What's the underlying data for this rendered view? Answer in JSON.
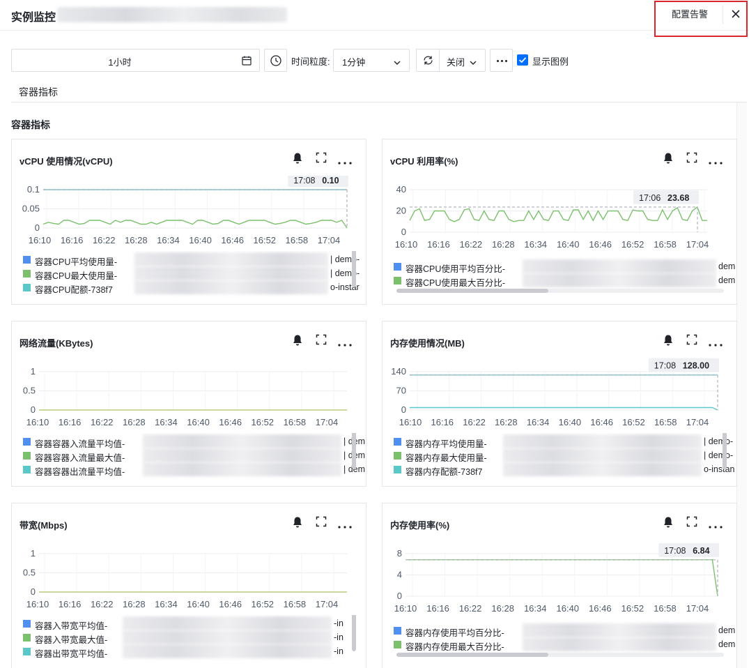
{
  "header": {
    "title": "实例监控",
    "config_alert_label": "配置告警"
  },
  "toolbar": {
    "time_range": "1小时",
    "granularity_label": "时间粒度:",
    "granularity_value": "1分钟",
    "auto_refresh_value": "关闭",
    "show_legend_label": "显示图例",
    "show_legend_checked": true
  },
  "tabs": [
    {
      "label": "容器指标",
      "active": true
    }
  ],
  "section_title": "容器指标",
  "x_ticks": [
    "16:10",
    "16:16",
    "16:22",
    "16:28",
    "16:34",
    "16:40",
    "16:46",
    "16:52",
    "16:58",
    "17:04"
  ],
  "charts": [
    {
      "title": "vCPU 使用情况(vCPU)",
      "tooltip_time": "17:08",
      "tooltip_value": "0.10",
      "y_ticks": [
        "0.1",
        "0.05",
        "0"
      ],
      "legend": [
        {
          "name": "容器CPU平均使用量-",
          "suffix": "| demo-",
          "color": "#4e8ff0"
        },
        {
          "name": "容器CPU最大使用量-",
          "suffix": "| demo-",
          "color": "#7cc06c"
        },
        {
          "name": "容器CPU配额-738f7",
          "suffix": "o-instar",
          "color": "#5ac8c8"
        }
      ]
    },
    {
      "title": "vCPU 利用率(%)",
      "tooltip_time": "17:06",
      "tooltip_value": "23.68",
      "y_ticks": [
        "40",
        "20",
        "0"
      ],
      "legend": [
        {
          "name": "容器CPU使用平均百分比-",
          "suffix": "dem",
          "color": "#4e8ff0"
        },
        {
          "name": "容器CPU使用最大百分比-",
          "suffix": "dem",
          "color": "#7cc06c"
        }
      ]
    },
    {
      "title": "网络流量(KBytes)",
      "y_ticks": [
        "1",
        "0.5",
        "0"
      ],
      "legend": [
        {
          "name": "容器容器入流量平均值-",
          "suffix": "| dem",
          "color": "#4e8ff0"
        },
        {
          "name": "容器容器入流量最大值-",
          "suffix": "| dem",
          "color": "#7cc06c"
        },
        {
          "name": "容器容器出流量平均值-",
          "suffix": "| dem",
          "color": "#5ac8c8"
        }
      ]
    },
    {
      "title": "内存使用情况(MB)",
      "tooltip_time": "17:08",
      "tooltip_value": "128.00",
      "y_ticks": [
        "140",
        "70",
        "0"
      ],
      "legend": [
        {
          "name": "容器内存平均使用量-",
          "suffix": "| demo-",
          "color": "#4e8ff0"
        },
        {
          "name": "容器内存最大使用量-",
          "suffix": "| demo-",
          "color": "#7cc06c"
        },
        {
          "name": "容器内存配额-738f7",
          "suffix": "o-instan",
          "color": "#5ac8c8"
        }
      ]
    },
    {
      "title": "带宽(Mbps)",
      "y_ticks": [
        "1",
        "0.5",
        "0"
      ],
      "legend": [
        {
          "name": "容器入带宽平均值-",
          "suffix": "-in",
          "color": "#4e8ff0"
        },
        {
          "name": "容器入带宽最大值-",
          "suffix": "-in",
          "color": "#7cc06c"
        },
        {
          "name": "容器出带宽平均值-",
          "suffix": "-in",
          "color": "#5ac8c8"
        }
      ]
    },
    {
      "title": "内存使用率(%)",
      "tooltip_time": "17:08",
      "tooltip_value": "6.84",
      "y_ticks": [
        "8",
        "4",
        "0"
      ],
      "legend": [
        {
          "name": "容器内存使用平均百分比-",
          "suffix": "dem",
          "color": "#4e8ff0"
        },
        {
          "name": "容器内存使用最大百分比-",
          "suffix": "dem",
          "color": "#7cc06c"
        }
      ]
    }
  ],
  "chart_data": [
    {
      "type": "line",
      "title": "vCPU 使用情况(vCPU)",
      "ylim": [
        0,
        0.1
      ],
      "x_range": [
        "16:09",
        "17:08"
      ],
      "series": [
        {
          "name": "容器CPU平均使用量",
          "values": [
            0.01,
            0.015,
            0.012,
            0.01,
            0.02,
            0.02,
            0.015,
            0.01,
            0.012,
            0.02,
            0.02,
            0.02,
            0.015,
            0.01,
            0.02,
            0.015,
            0.02,
            0.02,
            0.015,
            0.01,
            0.01,
            0.015,
            0.01,
            0.015,
            0.02,
            0.02,
            0.02,
            0.02,
            0.015,
            0.01,
            0.02,
            0.02,
            0.015,
            0.01,
            0.012,
            0.02,
            0.02,
            0.015,
            0.01,
            0.015,
            0.02,
            0.02,
            0.02,
            0.02,
            0.015,
            0.01,
            0.012,
            0.015,
            0.02,
            0.02,
            0.015,
            0.01,
            0.012,
            0.015,
            0.02,
            0.02,
            0.02,
            0.015,
            0.02,
            0.0
          ]
        },
        {
          "name": "容器CPU配额",
          "values": [
            0.1,
            0.1,
            0.1,
            0.1,
            0.1,
            0.1,
            0.1,
            0.1,
            0.1,
            0.1,
            0.1,
            0.1,
            0.1,
            0.1,
            0.1,
            0.1,
            0.1,
            0.1,
            0.1,
            0.1,
            0.1,
            0.1,
            0.1,
            0.1,
            0.1,
            0.1,
            0.1,
            0.1,
            0.1,
            0.1,
            0.1,
            0.1,
            0.1,
            0.1,
            0.1,
            0.1,
            0.1,
            0.1,
            0.1,
            0.1,
            0.1,
            0.1,
            0.1,
            0.1,
            0.1,
            0.1,
            0.1,
            0.1,
            0.1,
            0.1,
            0.1,
            0.1,
            0.1,
            0.1,
            0.1,
            0.1,
            0.1,
            0.1,
            0.1,
            0.1
          ]
        }
      ]
    },
    {
      "type": "line",
      "title": "vCPU 利用率(%)",
      "ylim": [
        0,
        40
      ],
      "x_range": [
        "16:09",
        "17:08"
      ],
      "series": [
        {
          "name": "容器CPU使用最大百分比",
          "values": [
            11,
            20,
            22,
            11,
            12,
            20,
            20,
            20,
            12,
            10,
            12,
            21,
            22,
            12,
            11,
            20,
            12,
            11,
            20,
            20,
            12,
            10,
            11,
            11,
            20,
            12,
            20,
            12,
            11,
            20,
            20,
            12,
            11,
            21,
            21,
            12,
            20,
            11,
            20,
            12,
            20,
            20,
            20,
            12,
            11,
            21,
            20,
            20,
            12,
            11,
            11,
            21,
            12,
            20,
            23,
            12,
            11,
            20,
            23.68,
            11,
            11
          ]
        }
      ]
    },
    {
      "type": "line",
      "title": "网络流量(KBytes)",
      "ylim": [
        0,
        1
      ],
      "x_range": [
        "16:09",
        "17:08"
      ],
      "series": [
        {
          "name": "容器容器入流量最大值",
          "values": [
            0,
            0,
            0,
            0,
            0,
            0,
            0,
            0,
            0,
            0,
            0,
            0,
            0,
            0,
            0,
            0,
            0,
            0,
            0,
            0,
            0,
            0,
            0,
            0,
            0,
            0,
            0,
            0,
            0,
            0,
            0,
            0,
            0,
            0,
            0,
            0,
            0,
            0,
            0,
            0,
            0,
            0,
            0,
            0,
            0,
            0,
            0,
            0,
            0,
            0,
            0,
            0,
            0,
            0,
            0,
            0,
            0,
            0,
            0,
            0
          ]
        }
      ]
    },
    {
      "type": "line",
      "title": "内存使用情况(MB)",
      "ylim": [
        0,
        140
      ],
      "x_range": [
        "16:09",
        "17:08"
      ],
      "series": [
        {
          "name": "容器内存配额",
          "values": [
            128,
            128,
            128,
            128,
            128,
            128,
            128,
            128,
            128,
            128,
            128,
            128,
            128,
            128,
            128,
            128,
            128,
            128,
            128,
            128,
            128,
            128,
            128,
            128,
            128,
            128,
            128,
            128,
            128,
            128,
            128,
            128,
            128,
            128,
            128,
            128,
            128,
            128,
            128,
            128,
            128,
            128,
            128,
            128,
            128,
            128,
            128,
            128,
            128,
            128,
            128,
            128,
            128,
            128,
            128,
            128,
            128,
            128,
            128,
            128.0
          ]
        },
        {
          "name": "容器内存平均使用量",
          "values": [
            9,
            9,
            9,
            9,
            9,
            9,
            9,
            9,
            9,
            9,
            9,
            9,
            9,
            9,
            9,
            9,
            9,
            9,
            9,
            9,
            9,
            9,
            9,
            9,
            9,
            9,
            9,
            9,
            9,
            9,
            9,
            9,
            9,
            9,
            9,
            9,
            9,
            9,
            9,
            9,
            9,
            9,
            9,
            9,
            9,
            9,
            9,
            9,
            9,
            9,
            9,
            9,
            9,
            9,
            9,
            9,
            9,
            9,
            9,
            0
          ]
        }
      ]
    },
    {
      "type": "line",
      "title": "带宽(Mbps)",
      "ylim": [
        0,
        1
      ],
      "x_range": [
        "16:09",
        "17:08"
      ],
      "series": [
        {
          "name": "容器入带宽最大值",
          "values": [
            0,
            0,
            0,
            0,
            0,
            0,
            0,
            0,
            0,
            0,
            0,
            0,
            0,
            0,
            0,
            0,
            0,
            0,
            0,
            0,
            0,
            0,
            0,
            0,
            0,
            0,
            0,
            0,
            0,
            0,
            0,
            0,
            0,
            0,
            0,
            0,
            0,
            0,
            0,
            0,
            0,
            0,
            0,
            0,
            0,
            0,
            0,
            0,
            0,
            0,
            0,
            0,
            0,
            0,
            0,
            0,
            0,
            0,
            0,
            0
          ]
        }
      ]
    },
    {
      "type": "line",
      "title": "内存使用率(%)",
      "ylim": [
        0,
        8
      ],
      "x_range": [
        "16:09",
        "17:08"
      ],
      "series": [
        {
          "name": "容器内存使用最大百分比",
          "values": [
            6.84,
            6.84,
            6.84,
            6.84,
            6.84,
            6.84,
            6.84,
            6.84,
            6.84,
            6.84,
            6.84,
            6.84,
            6.84,
            6.84,
            6.84,
            6.84,
            6.84,
            6.84,
            6.84,
            6.84,
            6.84,
            6.84,
            6.84,
            6.84,
            6.84,
            6.84,
            6.84,
            6.84,
            6.84,
            6.84,
            6.84,
            6.84,
            6.84,
            6.84,
            6.84,
            6.84,
            6.84,
            6.84,
            6.84,
            6.84,
            6.84,
            6.84,
            6.84,
            6.84,
            6.84,
            6.84,
            6.84,
            6.84,
            6.84,
            6.84,
            6.84,
            6.84,
            6.84,
            6.84,
            6.84,
            6.84,
            6.84,
            6.84,
            6.84,
            0
          ]
        }
      ]
    }
  ]
}
